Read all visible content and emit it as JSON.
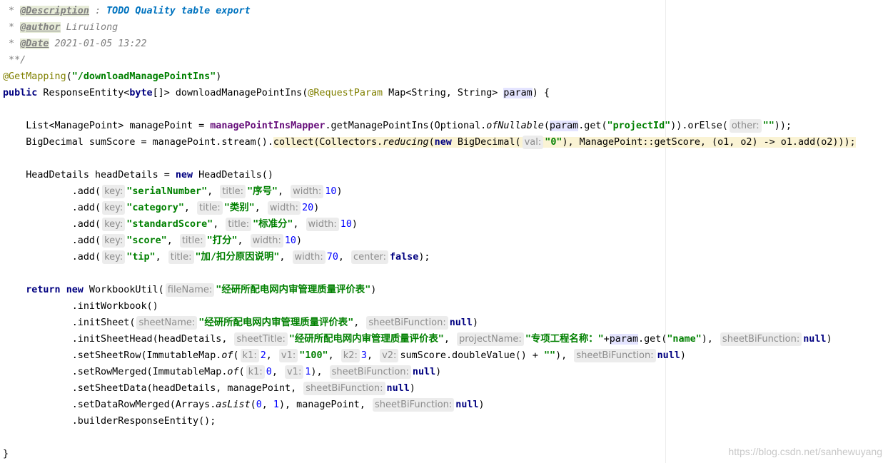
{
  "code": {
    "line1": {
      "star": " * ",
      "tag": "@Description",
      "sep": " : ",
      "todo": "TODO Quality table export"
    },
    "line2": {
      "star": " * ",
      "tag": "@author",
      "rest": " Liruilong"
    },
    "line3": {
      "star": " * ",
      "tag": "@Date",
      "rest": " 2021-01-05 13:22"
    },
    "line4": {
      "text": " **/"
    },
    "line5": {
      "ann": "@GetMapping",
      "lp": "(",
      "str": "\"/downloadManagePointIns\"",
      "rp": ")"
    },
    "line6": {
      "kw": "public",
      "t1": " ResponseEntity<",
      "kw2": "byte",
      "t2": "[]> downloadManagePointIns(",
      "ann": "@RequestParam",
      "t3": " Map<String, String> ",
      "par": "param",
      "t4": ") {"
    },
    "line8": {
      "t1": "    List<ManagePoint> managePoint = ",
      "fld": "managePointInsMapper",
      "t2": ".getManagePointIns(Optional.",
      "it": "ofNullable",
      "t3": "(",
      "par": "param",
      "t4": ".get(",
      "str": "\"projectId\"",
      "t5": ")).orElse(",
      "hint": "other:",
      "str2": "\"\"",
      "t6": "));"
    },
    "line9": {
      "t1": "    BigDecimal sumScore = managePoint.stream().",
      "h1": "collect(Collectors.",
      "hit": "reducing",
      "h2": "(",
      "hkw": "new",
      "h3": " BigDecimal(",
      "hint": "val:",
      "hstr": "\"0\"",
      "h4": "), ManagePoint::getScore, (o1, o2) -> o1.add(o2)));"
    },
    "line11": {
      "t1": "    HeadDetails headDetails = ",
      "kw": "new",
      "t2": " HeadDetails()"
    },
    "line12": {
      "t1": "            .add(",
      "h1": "key:",
      "s1": "\"serialNumber\"",
      "c1": ", ",
      "h2": "title:",
      "s2": "\"序号\"",
      "c2": ", ",
      "h3": "width:",
      "n1": "10",
      "t2": ")"
    },
    "line13": {
      "t1": "            .add(",
      "h1": "key:",
      "s1": "\"category\"",
      "c1": ", ",
      "h2": "title:",
      "s2": "\"类别\"",
      "c2": ", ",
      "h3": "width:",
      "n1": "20",
      "t2": ")"
    },
    "line14": {
      "t1": "            .add(",
      "h1": "key:",
      "s1": "\"standardScore\"",
      "c1": ", ",
      "h2": "title:",
      "s2": "\"标准分\"",
      "c2": ", ",
      "h3": "width:",
      "n1": "10",
      "t2": ")"
    },
    "line15": {
      "t1": "            .add(",
      "h1": "key:",
      "s1": "\"score\"",
      "c1": ", ",
      "h2": "title:",
      "s2": "\"打分\"",
      "c2": ", ",
      "h3": "width:",
      "n1": "10",
      "t2": ")"
    },
    "line16": {
      "t1": "            .add(",
      "h1": "key:",
      "s1": "\"tip\"",
      "c1": ", ",
      "h2": "title:",
      "s2": "\"加/扣分原因说明\"",
      "c2": ", ",
      "h3": "width:",
      "n1": "70",
      "c3": ", ",
      "h4": "center:",
      "kw": "false",
      "t2": ");"
    },
    "line18": {
      "t0": "    ",
      "kw1": "return",
      "sp": " ",
      "kw2": "new",
      "t1": " WorkbookUtil(",
      "hint": "fileName:",
      "str": "\"经研所配电网内审管理质量评价表\"",
      "t2": ")"
    },
    "line19": {
      "t1": "            .initWorkbook()"
    },
    "line20": {
      "t1": "            .initSheet(",
      "h1": "sheetName:",
      "s1": "\"经研所配电网内审管理质量评价表\"",
      "c1": ", ",
      "h2": "sheetBiFunction:",
      "kw": "null",
      "t2": ")"
    },
    "line21": {
      "t1": "            .initSheetHead(headDetails, ",
      "h1": "sheetTitle:",
      "s1": "\"经研所配电网内审管理质量评价表\"",
      "c1": ", ",
      "h2": "projectName:",
      "s2": "\"专项工程名称：\"",
      "t2": "+",
      "par": "param",
      "t3": ".get(",
      "s3": "\"name\"",
      "t4": "), ",
      "h3": "sheetBiFunction:",
      "kw": "null",
      "t5": ")"
    },
    "line22": {
      "t1": "            .setSheetRow(ImmutableMap.",
      "it": "of",
      "t2": "(",
      "h1": "k1:",
      "n1": "2",
      "c1": ", ",
      "h2": "v1:",
      "s1": "\"100\"",
      "c2": ", ",
      "h3": "k2:",
      "n2": "3",
      "c3": ", ",
      "h4": "v2:",
      "t3": "sumScore.doubleValue() + ",
      "s2": "\"\"",
      "t4": "), ",
      "h5": "sheetBiFunction:",
      "kw": "null",
      "t5": ")"
    },
    "line23": {
      "t1": "            .setRowMerged(ImmutableMap.",
      "it": "of",
      "t2": "(",
      "h1": "k1:",
      "n1": "0",
      "c1": ", ",
      "h2": "v1:",
      "n2": "1",
      "t3": "), ",
      "h3": "sheetBiFunction:",
      "kw": "null",
      "t4": ")"
    },
    "line24": {
      "t1": "            .setSheetData(headDetails, managePoint, ",
      "h1": "sheetBiFunction:",
      "kw": "null",
      "t2": ")"
    },
    "line25": {
      "t1": "            .setDataRowMerged(Arrays.",
      "it": "asList",
      "t2": "(",
      "n1": "0",
      "c1": ", ",
      "n2": "1",
      "t3": "), managePoint, ",
      "h1": "sheetBiFunction:",
      "kw": "null",
      "t4": ")"
    },
    "line26": {
      "t1": "            .builderResponseEntity();"
    },
    "line28": {
      "t1": "}"
    }
  },
  "watermark": "https://blog.csdn.net/sanhewuyang"
}
